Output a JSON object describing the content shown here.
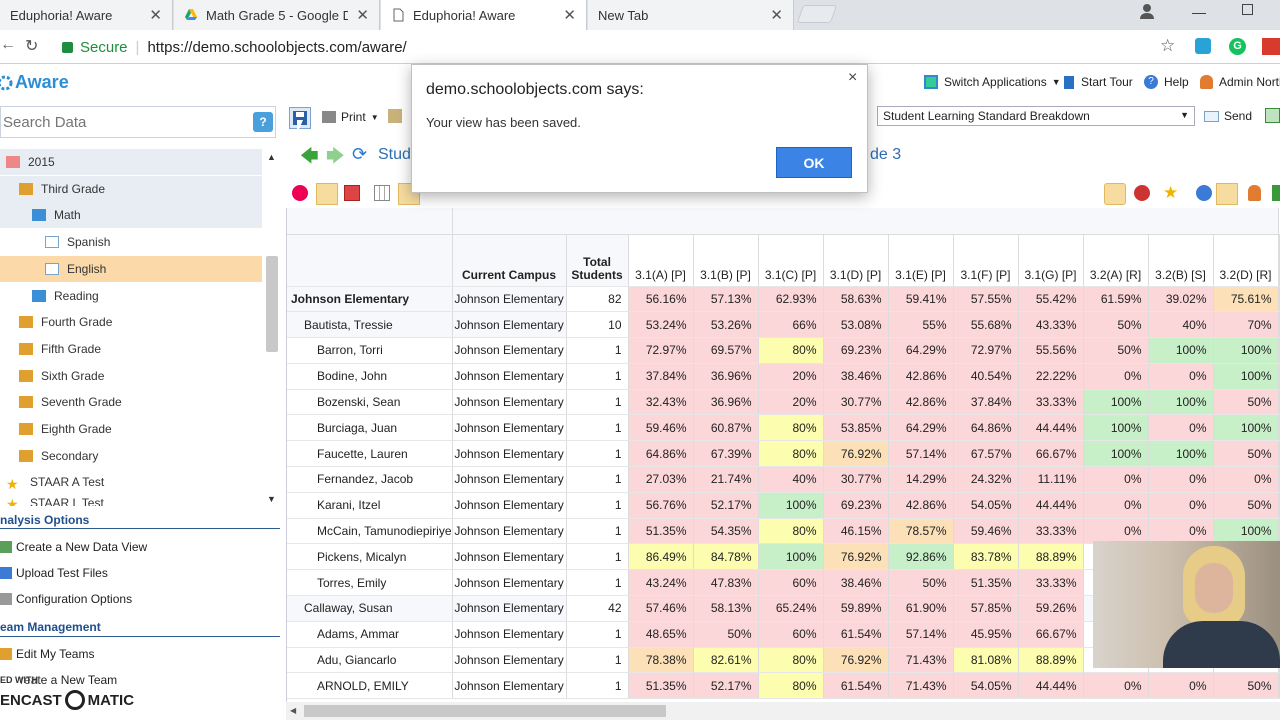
{
  "browser": {
    "tabs": [
      {
        "title": "Eduphoria! Aware"
      },
      {
        "title": "Math Grade 5 - Google D"
      },
      {
        "title": "Eduphoria! Aware"
      },
      {
        "title": "New Tab"
      }
    ],
    "secure_label": "Secure",
    "url": "https://demo.schoolobjects.com/aware/"
  },
  "app": {
    "logo": "Aware",
    "switch_apps": "Switch Applications",
    "start_tour": "Start Tour",
    "help": "Help",
    "admin": "Admin North",
    "search_placeholder": "Search Data",
    "print_label": "Print",
    "view_select": "Student Learning Standard Breakdown",
    "send_label": "Send",
    "breadcrumb_left": "Stude",
    "breadcrumb_right": "de 3"
  },
  "tree": [
    {
      "label": "2015",
      "icon": "calendar-icon",
      "indent": 0,
      "selected": false,
      "gray": true
    },
    {
      "label": "Third Grade",
      "icon": "group-icon",
      "indent": 1,
      "selected": false,
      "gray": true
    },
    {
      "label": "Math",
      "icon": "book-icon",
      "indent": 2,
      "selected": false,
      "gray": true
    },
    {
      "label": "Spanish",
      "icon": "test-icon",
      "indent": 3,
      "selected": false,
      "gray": false
    },
    {
      "label": "English",
      "icon": "test-icon",
      "indent": 3,
      "selected": true,
      "gray": false
    },
    {
      "label": "Reading",
      "icon": "book-icon",
      "indent": 2,
      "selected": false,
      "gray": false
    },
    {
      "label": "Fourth Grade",
      "icon": "group-icon",
      "indent": 1,
      "selected": false,
      "gray": false
    },
    {
      "label": "Fifth Grade",
      "icon": "group-icon",
      "indent": 1,
      "selected": false,
      "gray": false
    },
    {
      "label": "Sixth Grade",
      "icon": "group-icon",
      "indent": 1,
      "selected": false,
      "gray": false
    },
    {
      "label": "Seventh Grade",
      "icon": "group-icon",
      "indent": 1,
      "selected": false,
      "gray": false
    },
    {
      "label": "Eighth Grade",
      "icon": "group-icon",
      "indent": 1,
      "selected": false,
      "gray": false
    },
    {
      "label": "Secondary",
      "icon": "group-icon",
      "indent": 1,
      "selected": false,
      "gray": false
    },
    {
      "label": "STAAR A Test",
      "icon": "star-icon",
      "indent": 0,
      "selected": false,
      "gray": false
    },
    {
      "label": "STAAR L Test",
      "icon": "star-icon",
      "indent": 0,
      "selected": false,
      "gray": false
    }
  ],
  "analysis": {
    "title": "nalysis Options",
    "items": [
      "Create a New Data View",
      "Upload Test Files",
      "Configuration Options"
    ]
  },
  "team": {
    "title": "eam Management",
    "items": [
      "Edit My Teams",
      "reate a New Team"
    ]
  },
  "watermark": {
    "top": "ED WITH",
    "bottom": "ENCAST",
    "bottom2": "MATIC"
  },
  "dialog": {
    "title": "demo.schoolobjects.com says:",
    "message": "Your view has been saved.",
    "ok": "OK",
    "close": "×"
  },
  "grid": {
    "headers": [
      "Current Campus",
      "Total Students",
      "3.1(A) [P]",
      "3.1(B) [P]",
      "3.1(C) [P]",
      "3.1(D) [P]",
      "3.1(E) [P]",
      "3.1(F) [P]",
      "3.1(G) [P]",
      "3.2(A) [R]",
      "3.2(B) [S]",
      "3.2(D) [R]"
    ],
    "rows": [
      {
        "name": "Johnson Elementary",
        "level": 0,
        "campus": "Johnson Elementary",
        "total": "82",
        "vals": [
          "56.16%",
          "57.13%",
          "62.93%",
          "58.63%",
          "59.41%",
          "57.55%",
          "55.42%",
          "61.59%",
          "39.02%",
          "75.61%"
        ],
        "cls": [
          "r",
          "r",
          "r",
          "r",
          "r",
          "r",
          "r",
          "r",
          "r",
          "o"
        ]
      },
      {
        "name": "Bautista, Tressie",
        "level": 1,
        "campus": "Johnson Elementary",
        "total": "10",
        "vals": [
          "53.24%",
          "53.26%",
          "66%",
          "53.08%",
          "55%",
          "55.68%",
          "43.33%",
          "50%",
          "40%",
          "70%"
        ],
        "cls": [
          "r",
          "r",
          "r",
          "r",
          "r",
          "r",
          "r",
          "r",
          "r",
          "r"
        ]
      },
      {
        "name": "Barron, Torri",
        "level": 2,
        "campus": "Johnson Elementary",
        "total": "1",
        "vals": [
          "72.97%",
          "69.57%",
          "80%",
          "69.23%",
          "64.29%",
          "72.97%",
          "55.56%",
          "50%",
          "100%",
          "100%"
        ],
        "cls": [
          "r",
          "r",
          "y",
          "r",
          "r",
          "r",
          "r",
          "r",
          "g",
          "g"
        ]
      },
      {
        "name": "Bodine, John",
        "level": 2,
        "campus": "Johnson Elementary",
        "total": "1",
        "vals": [
          "37.84%",
          "36.96%",
          "20%",
          "38.46%",
          "42.86%",
          "40.54%",
          "22.22%",
          "0%",
          "0%",
          "100%"
        ],
        "cls": [
          "r",
          "r",
          "r",
          "r",
          "r",
          "r",
          "r",
          "r",
          "r",
          "g"
        ]
      },
      {
        "name": "Bozenski, Sean",
        "level": 2,
        "campus": "Johnson Elementary",
        "total": "1",
        "vals": [
          "32.43%",
          "36.96%",
          "20%",
          "30.77%",
          "42.86%",
          "37.84%",
          "33.33%",
          "100%",
          "100%",
          "50%"
        ],
        "cls": [
          "r",
          "r",
          "r",
          "r",
          "r",
          "r",
          "r",
          "g",
          "g",
          "r"
        ]
      },
      {
        "name": "Burciaga, Juan",
        "level": 2,
        "campus": "Johnson Elementary",
        "total": "1",
        "vals": [
          "59.46%",
          "60.87%",
          "80%",
          "53.85%",
          "64.29%",
          "64.86%",
          "44.44%",
          "100%",
          "0%",
          "100%"
        ],
        "cls": [
          "r",
          "r",
          "y",
          "r",
          "r",
          "r",
          "r",
          "g",
          "r",
          "g"
        ]
      },
      {
        "name": "Faucette, Lauren",
        "level": 2,
        "campus": "Johnson Elementary",
        "total": "1",
        "vals": [
          "64.86%",
          "67.39%",
          "80%",
          "76.92%",
          "57.14%",
          "67.57%",
          "66.67%",
          "100%",
          "100%",
          "50%"
        ],
        "cls": [
          "r",
          "r",
          "y",
          "o",
          "r",
          "r",
          "r",
          "g",
          "g",
          "r"
        ]
      },
      {
        "name": "Fernandez, Jacob",
        "level": 2,
        "campus": "Johnson Elementary",
        "total": "1",
        "vals": [
          "27.03%",
          "21.74%",
          "40%",
          "30.77%",
          "14.29%",
          "24.32%",
          "11.11%",
          "0%",
          "0%",
          "0%"
        ],
        "cls": [
          "r",
          "r",
          "r",
          "r",
          "r",
          "r",
          "r",
          "r",
          "r",
          "r"
        ]
      },
      {
        "name": "Karani, Itzel",
        "level": 2,
        "campus": "Johnson Elementary",
        "total": "1",
        "vals": [
          "56.76%",
          "52.17%",
          "100%",
          "69.23%",
          "42.86%",
          "54.05%",
          "44.44%",
          "0%",
          "0%",
          "50%"
        ],
        "cls": [
          "r",
          "r",
          "g",
          "r",
          "r",
          "r",
          "r",
          "r",
          "r",
          "r"
        ]
      },
      {
        "name": "McCain, Tamunodiepiriye",
        "level": 2,
        "campus": "Johnson Elementary",
        "total": "1",
        "vals": [
          "51.35%",
          "54.35%",
          "80%",
          "46.15%",
          "78.57%",
          "59.46%",
          "33.33%",
          "0%",
          "0%",
          "100%"
        ],
        "cls": [
          "r",
          "r",
          "y",
          "r",
          "o",
          "r",
          "r",
          "r",
          "r",
          "g"
        ]
      },
      {
        "name": "Pickens, Micalyn",
        "level": 2,
        "campus": "Johnson Elementary",
        "total": "1",
        "vals": [
          "86.49%",
          "84.78%",
          "100%",
          "76.92%",
          "92.86%",
          "83.78%",
          "88.89%",
          "",
          "",
          ""
        ],
        "cls": [
          "y",
          "y",
          "g",
          "o",
          "g",
          "y",
          "y",
          "",
          "",
          ""
        ]
      },
      {
        "name": "Torres, Emily",
        "level": 2,
        "campus": "Johnson Elementary",
        "total": "1",
        "vals": [
          "43.24%",
          "47.83%",
          "60%",
          "38.46%",
          "50%",
          "51.35%",
          "33.33%",
          "",
          "",
          ""
        ],
        "cls": [
          "r",
          "r",
          "r",
          "r",
          "r",
          "r",
          "r",
          "",
          "",
          ""
        ]
      },
      {
        "name": "Callaway, Susan",
        "level": 1,
        "campus": "Johnson Elementary",
        "total": "42",
        "vals": [
          "57.46%",
          "58.13%",
          "65.24%",
          "59.89%",
          "61.90%",
          "57.85%",
          "59.26%",
          "",
          "",
          ""
        ],
        "cls": [
          "r",
          "r",
          "r",
          "r",
          "r",
          "r",
          "r",
          "",
          "",
          ""
        ]
      },
      {
        "name": "Adams, Ammar",
        "level": 2,
        "campus": "Johnson Elementary",
        "total": "1",
        "vals": [
          "48.65%",
          "50%",
          "60%",
          "61.54%",
          "57.14%",
          "45.95%",
          "66.67%",
          "",
          "",
          ""
        ],
        "cls": [
          "r",
          "r",
          "r",
          "r",
          "r",
          "r",
          "r",
          "",
          "",
          ""
        ]
      },
      {
        "name": "Adu, Giancarlo",
        "level": 2,
        "campus": "Johnson Elementary",
        "total": "1",
        "vals": [
          "78.38%",
          "82.61%",
          "80%",
          "76.92%",
          "71.43%",
          "81.08%",
          "88.89%",
          "",
          "",
          ""
        ],
        "cls": [
          "o",
          "y",
          "y",
          "o",
          "r",
          "y",
          "y",
          "",
          "",
          ""
        ]
      },
      {
        "name": "ARNOLD, EMILY",
        "level": 2,
        "campus": "Johnson Elementary",
        "total": "1",
        "vals": [
          "51.35%",
          "52.17%",
          "80%",
          "61.54%",
          "71.43%",
          "54.05%",
          "44.44%",
          "0%",
          "0%",
          "50%"
        ],
        "cls": [
          "r",
          "r",
          "y",
          "r",
          "r",
          "r",
          "r",
          "r",
          "r",
          "r"
        ]
      }
    ]
  },
  "colors": {
    "accent": "#3b83e5",
    "red_cell": "#fcd7d9",
    "yellow_cell": "#fdfdb0",
    "green_cell": "#c7f0c8",
    "orange_cell": "#fbe0b8"
  }
}
